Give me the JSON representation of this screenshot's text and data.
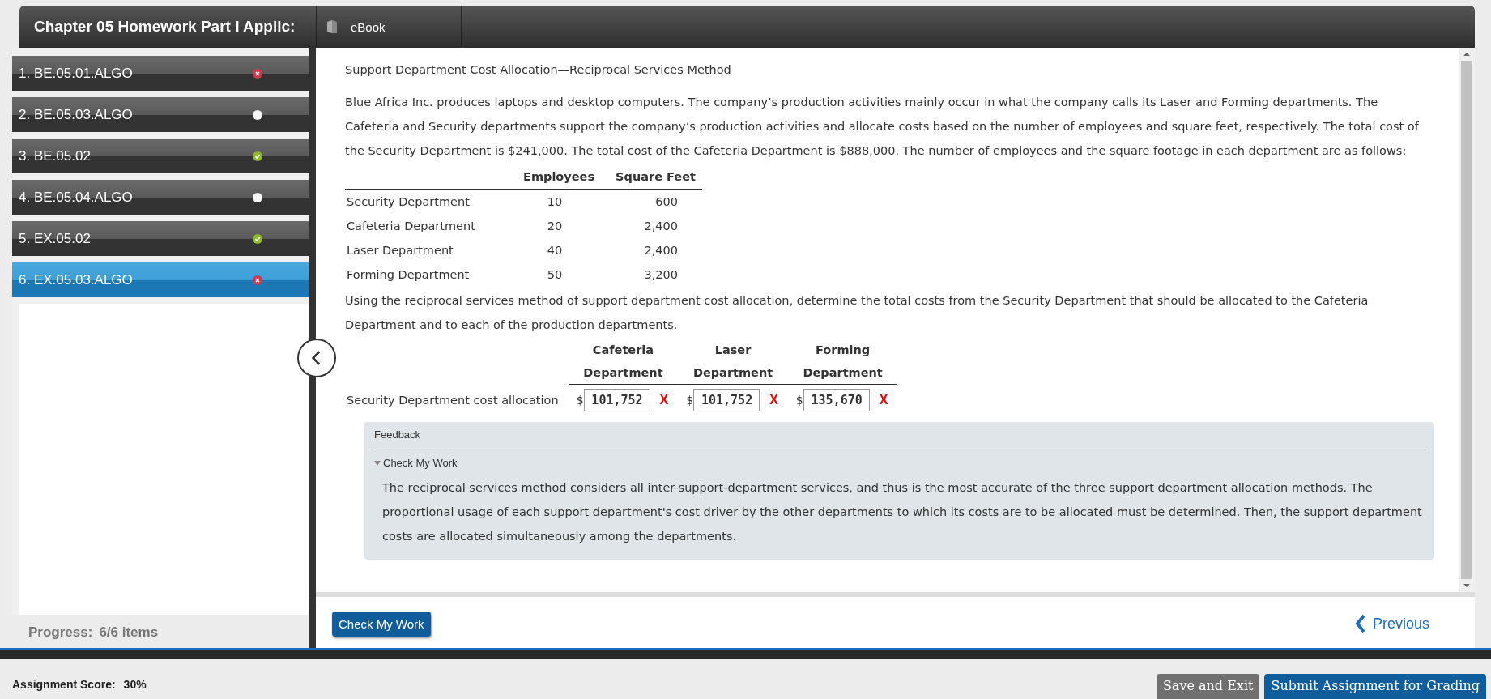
{
  "header": {
    "title": "Chapter 05 Homework Part I Applic:",
    "ebook": "eBook"
  },
  "sidebar": {
    "items": [
      {
        "label": "1. BE.05.01.ALGO",
        "kind": "incorrect",
        "selected": false
      },
      {
        "label": "2. BE.05.03.ALGO",
        "kind": "unanswered",
        "selected": false
      },
      {
        "label": "3. BE.05.02",
        "kind": "correct",
        "selected": false
      },
      {
        "label": "4. BE.05.04.ALGO",
        "kind": "unanswered",
        "selected": false
      },
      {
        "label": "5. EX.05.02",
        "kind": "correct",
        "selected": false
      },
      {
        "label": "6. EX.05.03.ALGO",
        "kind": "incorrect",
        "selected": true
      }
    ],
    "progress_label": "Progress:",
    "progress_value": "6/6 items"
  },
  "problem": {
    "title": "Support Department Cost Allocation—Reciprocal Services Method",
    "intro": "Blue Africa Inc. produces laptops and desktop computers. The company’s production activities mainly occur in what the company calls its Laser and Forming departments. The Cafeteria and Security departments support the company’s production activities and allocate costs based on the number of employees and square feet, respectively. The total cost of the Security Department is $241,000. The total cost of the Cafeteria Department is $888,000. The number of employees and the square footage in each department are as follows:",
    "data_table": {
      "columns": [
        "Employees",
        "Square Feet"
      ],
      "rows": [
        {
          "name": "Security Department",
          "employees": "10",
          "square_feet": "600"
        },
        {
          "name": "Cafeteria Department",
          "employees": "20",
          "square_feet": "2,400"
        },
        {
          "name": "Laser Department",
          "employees": "40",
          "square_feet": "2,400"
        },
        {
          "name": "Forming Department",
          "employees": "50",
          "square_feet": "3,200"
        }
      ]
    },
    "question": "Using the reciprocal services method of support department cost allocation, determine the total costs from the Security Department that should be allocated to the Cafeteria Department and to each of the production departments.",
    "answer_table": {
      "columns": [
        [
          "Cafeteria",
          "Department"
        ],
        [
          "Laser",
          "Department"
        ],
        [
          "Forming",
          "Department"
        ]
      ],
      "row_label": "Security Department cost allocation",
      "answers": [
        {
          "currency": "$",
          "value": "101,752",
          "correct": false,
          "mark": "X"
        },
        {
          "currency": "$",
          "value": "101,752",
          "correct": false,
          "mark": "X"
        },
        {
          "currency": "$",
          "value": "135,670",
          "correct": false,
          "mark": "X"
        }
      ]
    }
  },
  "feedback": {
    "title": "Feedback",
    "section": "Check My Work",
    "expanded": true,
    "text": "The reciprocal services method considers all inter-support-department services, and thus is the most accurate of the three support department allocation methods. The proportional usage of each support department's cost driver by the other departments to which its costs are to be allocated must be determined. Then, the support department costs are allocated simultaneously among the departments."
  },
  "toolbar": {
    "check_button": "Check My Work",
    "previous": "Previous"
  },
  "footer": {
    "score_label": "Assignment Score:",
    "score_value": "30%",
    "save_button": "Save and Exit",
    "submit_button": "Submit Assignment for Grading"
  }
}
